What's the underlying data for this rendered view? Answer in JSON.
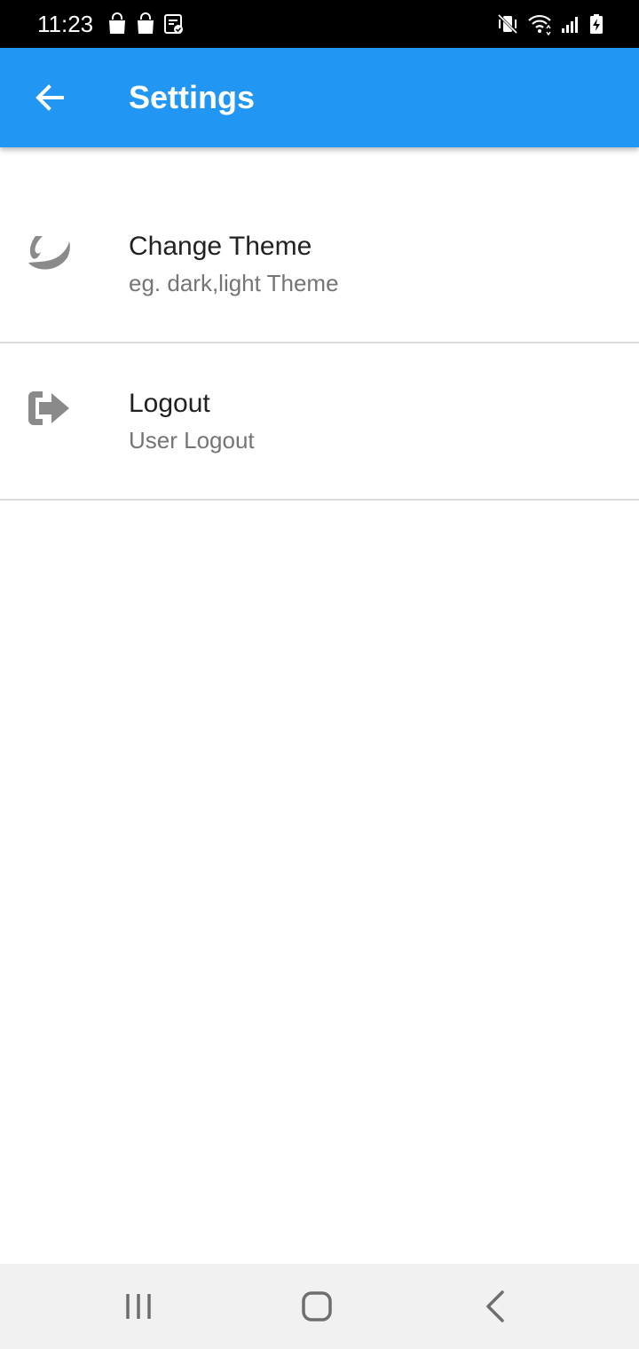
{
  "status_bar": {
    "time": "11:23",
    "left_icons": [
      "shopping-bag-icon",
      "shopping-bag-icon",
      "task-check-icon"
    ],
    "right_icons": [
      "vibrate-mute-icon",
      "wifi-icon",
      "signal-icon",
      "battery-charging-icon"
    ]
  },
  "app_bar": {
    "title": "Settings",
    "background_color": "#2196F3",
    "back_icon": "arrow-back-icon"
  },
  "settings": {
    "items": [
      {
        "icon": "theme-icon",
        "title": "Change Theme",
        "subtitle": "eg. dark,light Theme"
      },
      {
        "icon": "logout-icon",
        "title": "Logout",
        "subtitle": "User Logout"
      }
    ]
  },
  "nav_bar": {
    "buttons": [
      "recents-icon",
      "home-icon",
      "back-icon"
    ]
  }
}
